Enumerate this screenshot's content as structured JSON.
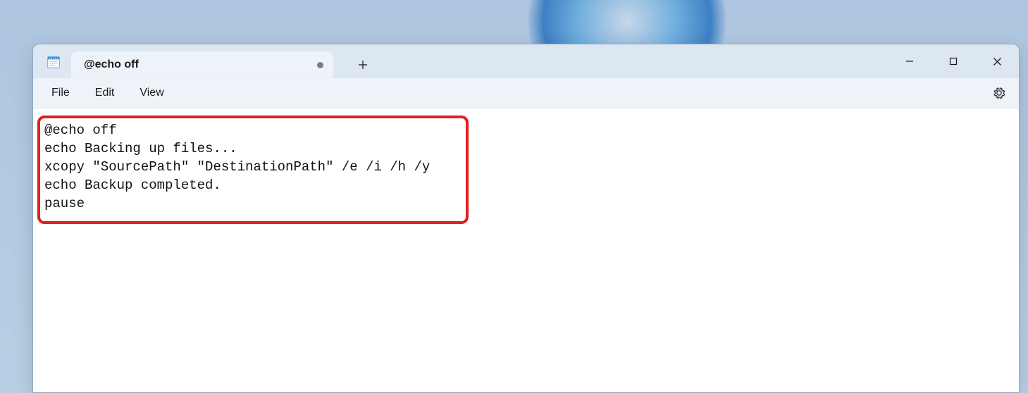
{
  "tab": {
    "title": "@echo off",
    "modified": true
  },
  "menubar": {
    "file": "File",
    "edit": "Edit",
    "view": "View"
  },
  "editor": {
    "lines": [
      "@echo off",
      "echo Backing up files...",
      "xcopy \"SourcePath\" \"DestinationPath\" /e /i /h /y",
      "echo Backup completed.",
      "pause"
    ]
  }
}
